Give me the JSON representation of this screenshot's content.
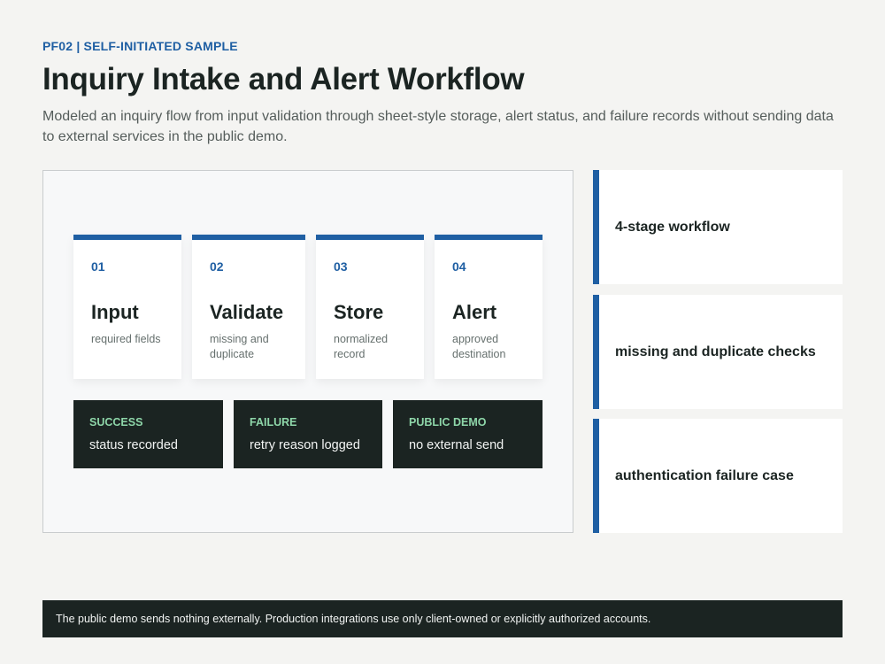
{
  "header": {
    "eyebrow": "PF02 | SELF-INITIATED SAMPLE",
    "title": "Inquiry Intake and Alert Workflow",
    "description": "Modeled an inquiry flow from input validation through sheet-style storage, alert status, and failure records without sending data to external services in the public demo."
  },
  "stages": [
    {
      "number": "01",
      "name": "Input",
      "note": "required fields"
    },
    {
      "number": "02",
      "name": "Validate",
      "note": "missing and duplicate"
    },
    {
      "number": "03",
      "name": "Store",
      "note": "normalized record"
    },
    {
      "number": "04",
      "name": "Alert",
      "note": "approved destination"
    }
  ],
  "statuses": [
    {
      "label": "SUCCESS",
      "text": "status recorded"
    },
    {
      "label": "FAILURE",
      "text": "retry reason logged"
    },
    {
      "label": "PUBLIC DEMO",
      "text": "no external send"
    }
  ],
  "features": [
    {
      "label": "4-stage workflow"
    },
    {
      "label": "missing and duplicate checks"
    },
    {
      "label": "authentication failure case"
    }
  ],
  "footer": {
    "text": "The public demo sends nothing externally. Production integrations use only client-owned or explicitly authorized accounts."
  },
  "colors": {
    "accent": "#1f5fa3",
    "dark": "#1b2422",
    "status_label": "#8ed6a9",
    "background": "#f4f4f2"
  }
}
